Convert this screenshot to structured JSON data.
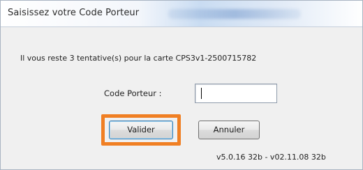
{
  "dialog": {
    "title": "Saisissez votre Code Porteur",
    "message": "Il vous reste 3 tentative(s) pour la carte CPS3v1-2500715782",
    "code_label": "Code Porteur :",
    "code_value": "",
    "buttons": {
      "valider": "Valider",
      "annuler": "Annuler"
    },
    "version": "v5.0.16 32b - v02.11.08 32b"
  },
  "colors": {
    "highlight": "#f07f23",
    "background": "#f0f0f0"
  }
}
